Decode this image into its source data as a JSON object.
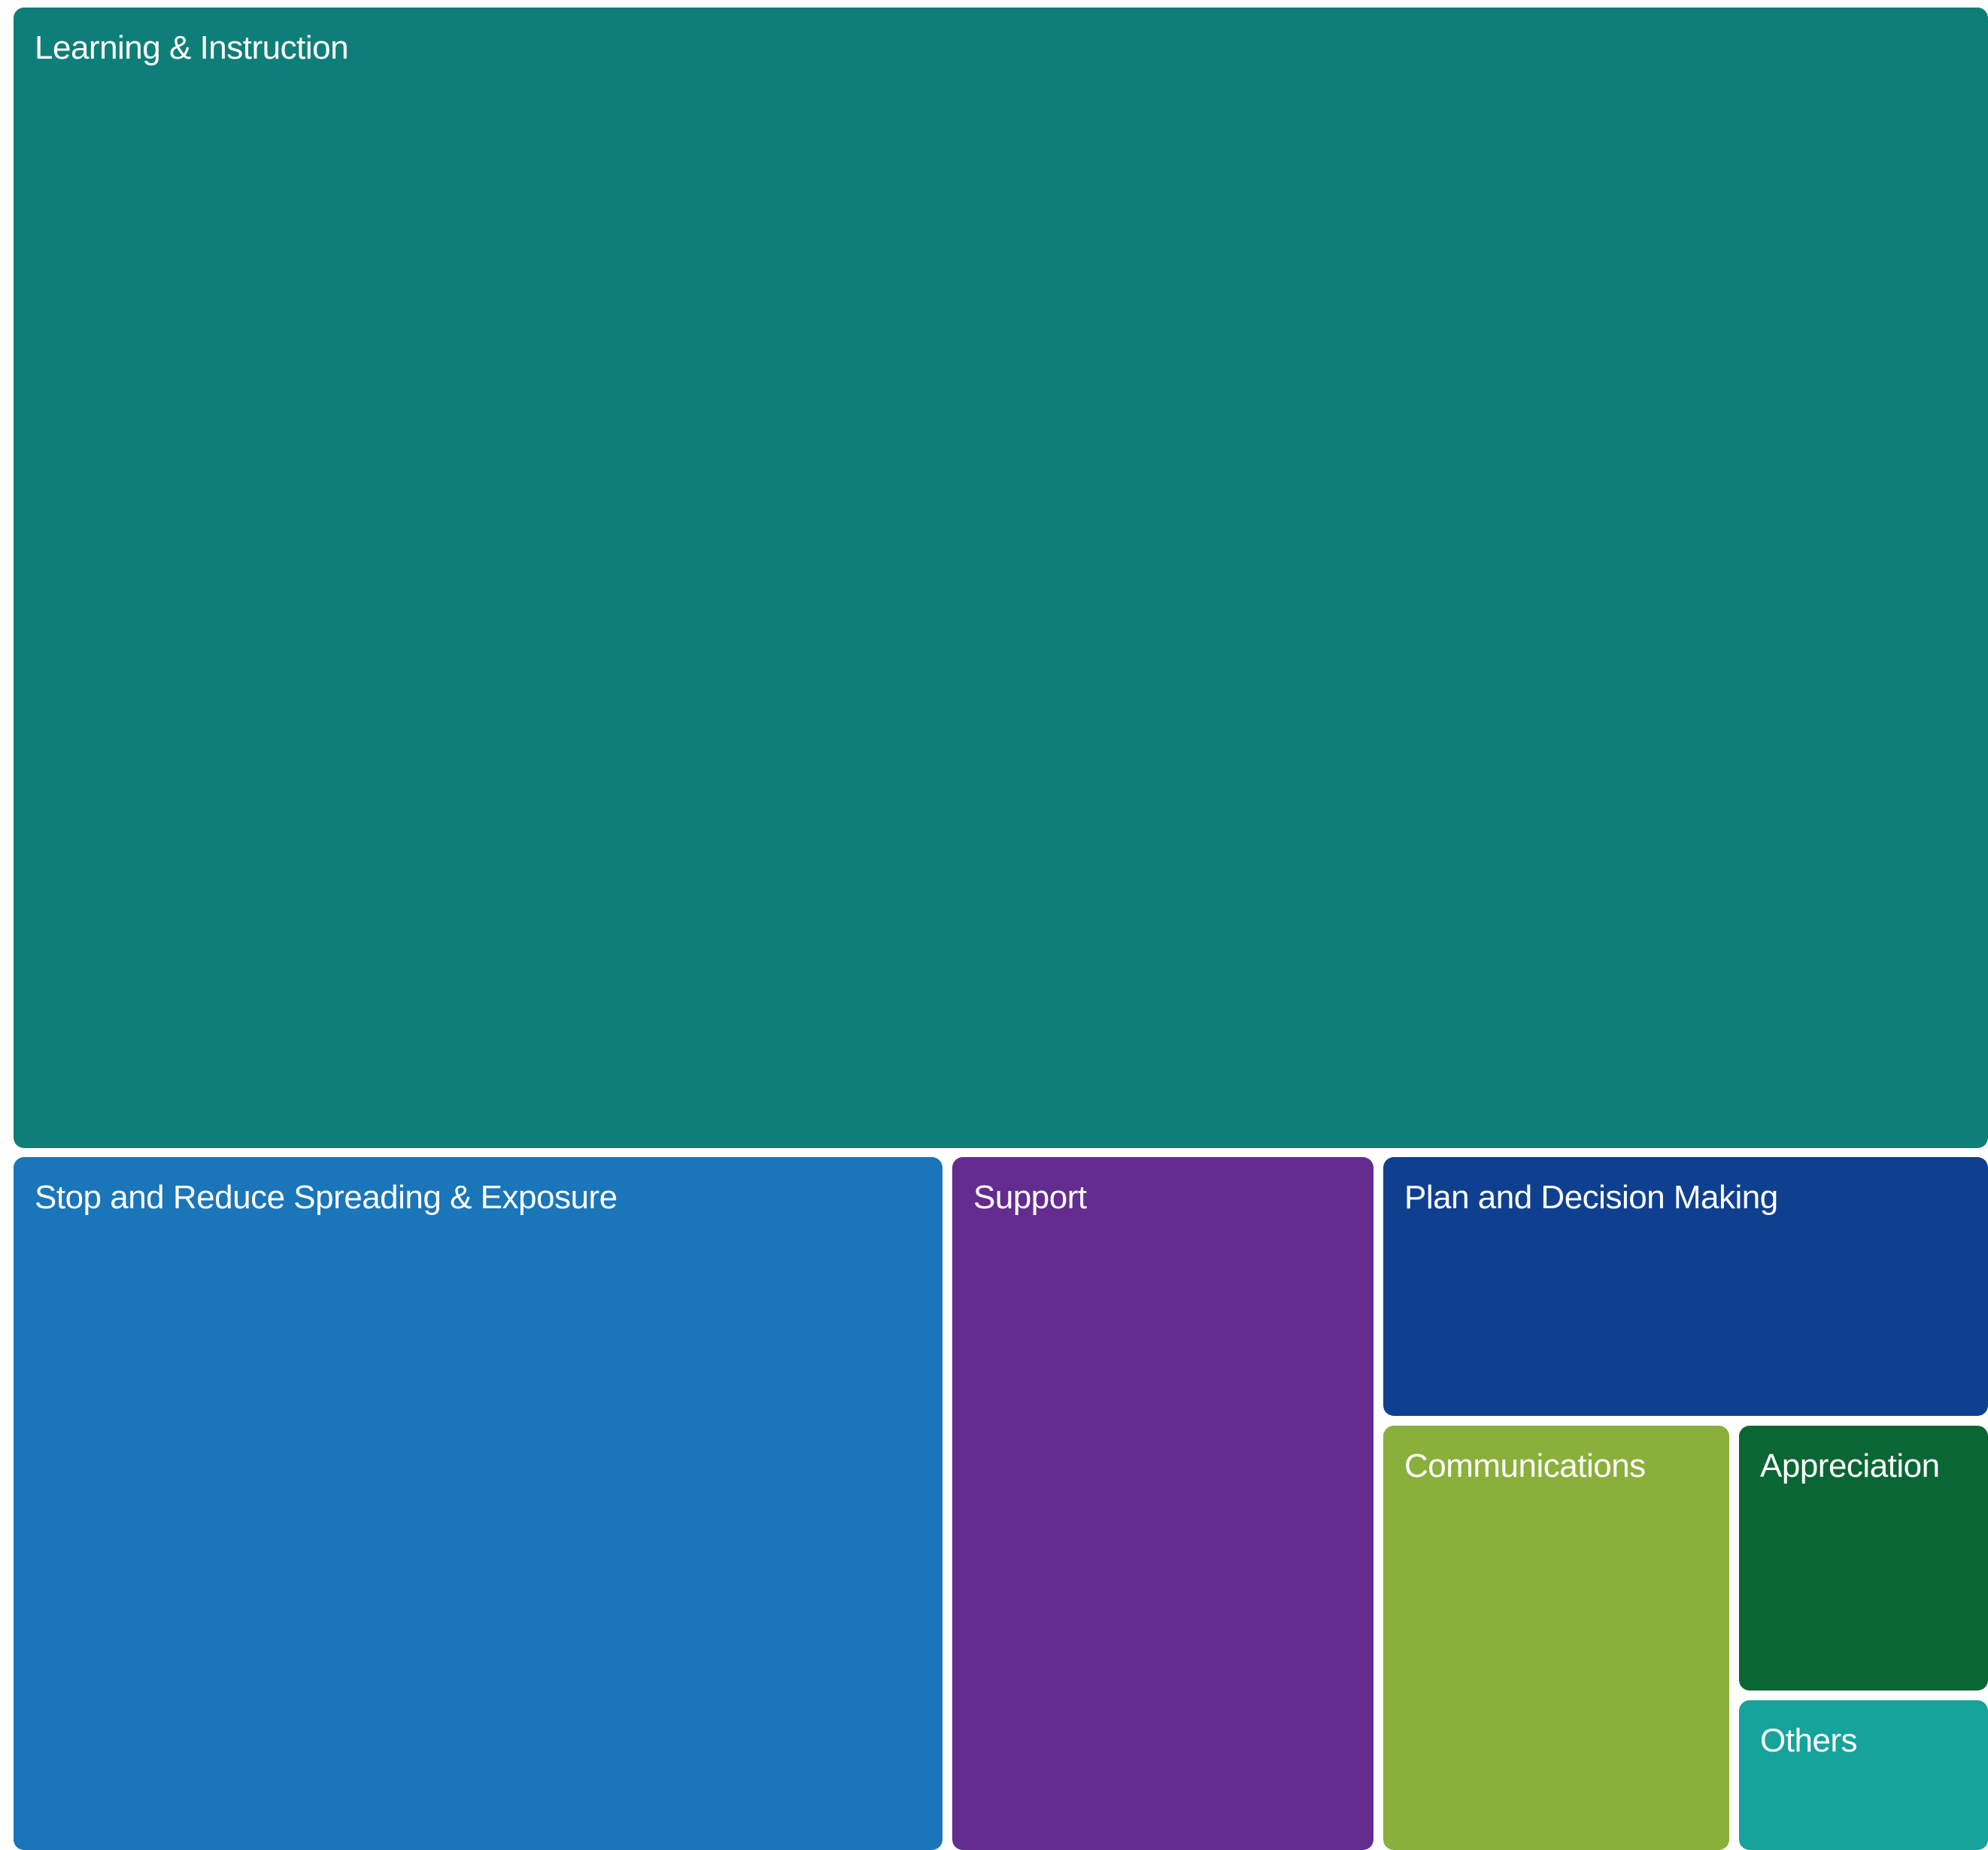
{
  "chart_data": {
    "type": "treemap",
    "tiles": [
      {
        "label": "Learning & Instruction",
        "color": "#0e7e78"
      },
      {
        "label": "Stop and Reduce Spreading & Exposure",
        "color": "#1a75b9"
      },
      {
        "label": "Support",
        "color": "#642c8e"
      },
      {
        "label": "Plan and Decision Making",
        "color": "#0f4090"
      },
      {
        "label": "Communications",
        "color": "#8aaf3b"
      },
      {
        "label": "Appreciation",
        "color": "#0a6634"
      },
      {
        "label": "Others",
        "color": "#15a39b"
      }
    ]
  }
}
